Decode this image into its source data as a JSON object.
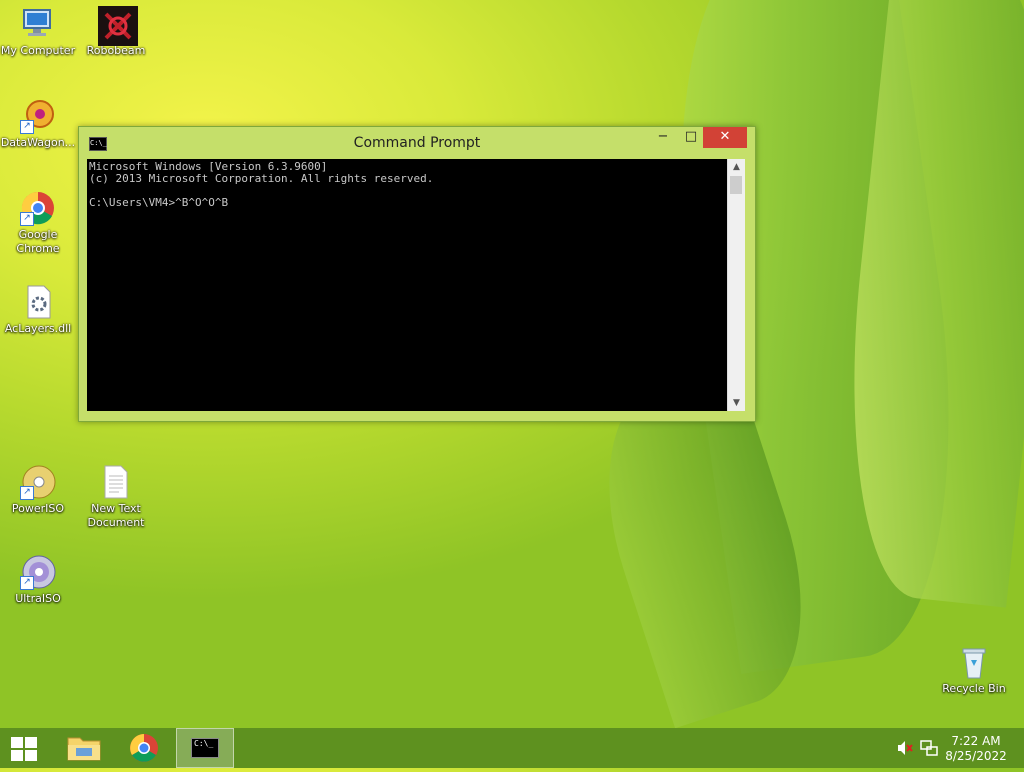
{
  "desktop": {
    "icons": [
      {
        "label_line1": "My Computer",
        "label_line2": ""
      },
      {
        "label_line1": "Robobeam",
        "label_line2": ""
      },
      {
        "label_line1": "DataWagon...",
        "label_line2": ""
      },
      {
        "label_line1": "Google",
        "label_line2": "Chrome"
      },
      {
        "label_line1": "AcLayers.dll",
        "label_line2": ""
      },
      {
        "label_line1": "PowerISO",
        "label_line2": ""
      },
      {
        "label_line1": "New Text",
        "label_line2": "Document"
      },
      {
        "label_line1": "UltraISO",
        "label_line2": ""
      },
      {
        "label_line1": "Recycle Bin",
        "label_line2": ""
      }
    ]
  },
  "window": {
    "title": "Command Prompt",
    "icon_text": "C:\\_",
    "minimize": "−",
    "maximize": "□",
    "close": "✕",
    "console_lines": [
      "Microsoft Windows [Version 6.3.9600]",
      "(c) 2013 Microsoft Corporation. All rights reserved.",
      "",
      "C:\\Users\\VM4>^B^O^O^B"
    ],
    "scroll_up": "▲",
    "scroll_down": "▼"
  },
  "taskbar": {
    "clock_time": "7:22 AM",
    "clock_date": "8/25/2022",
    "cmd_icon_text": "C:\\_"
  },
  "colors": {
    "close_button": "#d24236",
    "console_bg": "#000000",
    "console_text": "#c8c8c8",
    "taskbar": "#5a8c1e"
  },
  "icons": {
    "tray_volume": "speaker-muted-icon",
    "tray_network": "network-icon"
  }
}
